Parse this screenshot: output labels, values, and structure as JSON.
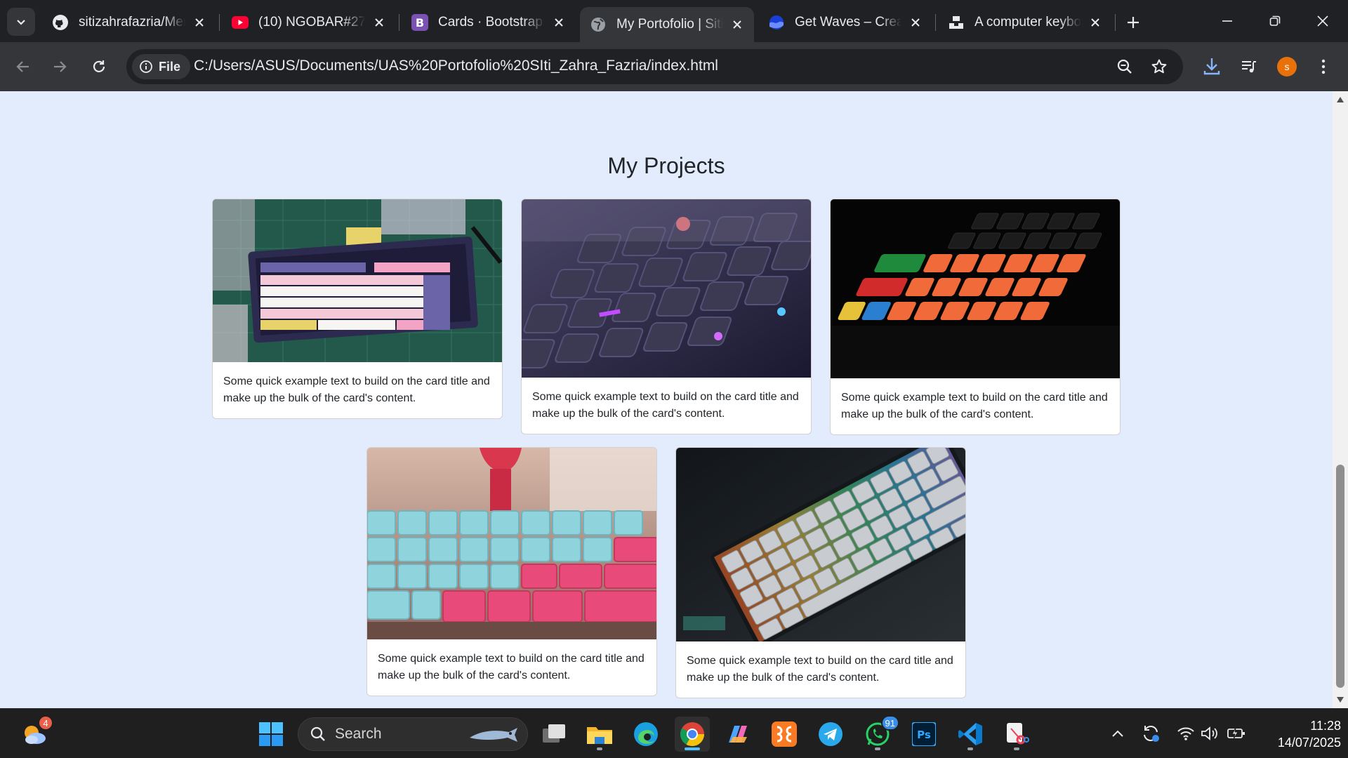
{
  "browser": {
    "tabs": [
      {
        "title": "sitizahrafazria/Men",
        "icon": "github-icon"
      },
      {
        "title": "(10) NGOBAR#27",
        "icon": "youtube-icon"
      },
      {
        "title": "Cards · Bootstrap v",
        "icon": "bootstrap-icon"
      },
      {
        "title": "My Portofolio | Siti",
        "icon": "globe-icon"
      },
      {
        "title": "Get Waves – Creat",
        "icon": "waves-icon"
      },
      {
        "title": "A computer keybo",
        "icon": "unsplash-icon"
      }
    ],
    "chip_label": "File",
    "url": "C:/Users/ASUS/Documents/UAS%20Portofolio%20SIti_Zahra_Fazria/index.html",
    "profile_initial": "s"
  },
  "page": {
    "heading": "My Projects",
    "cards": [
      {
        "text": "Some quick example text to build on the card title and make up the bulk of the card's content."
      },
      {
        "text": "Some quick example text to build on the card title and make up the bulk of the card's content."
      },
      {
        "text": "Some quick example text to build on the card title and make up the bulk of the card's content."
      },
      {
        "text": "Some quick example text to build on the card title and make up the bulk of the card's content."
      },
      {
        "text": "Some quick example text to build on the card title and make up the bulk of the card's content."
      }
    ]
  },
  "taskbar": {
    "weather_badge": "4",
    "search_label": "Search",
    "whatsapp_badge": "91",
    "time": "11:28",
    "date": "14/07/2025"
  },
  "colors": {
    "page_bg": "#e2ecfd",
    "browser_frame": "#202124",
    "toolbar": "#35363a",
    "accent": "#4cc2ff"
  }
}
